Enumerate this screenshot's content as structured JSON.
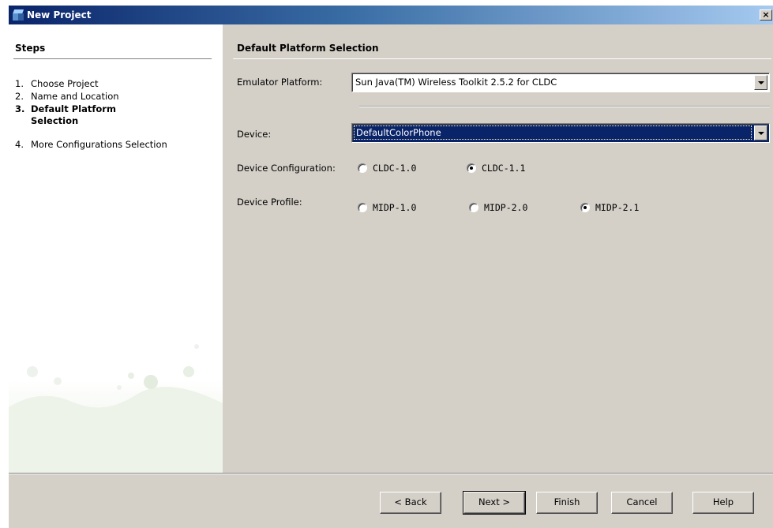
{
  "window": {
    "title": "New Project",
    "close_glyph": "×"
  },
  "steps": {
    "heading": "Steps",
    "items": [
      {
        "num": "1.",
        "label": "Choose Project"
      },
      {
        "num": "2.",
        "label": "Name and Location"
      },
      {
        "num": "3.",
        "label": "Default Platform Selection"
      },
      {
        "num": "4.",
        "label": "More Configurations Selection"
      }
    ]
  },
  "content": {
    "heading": "Default Platform Selection",
    "emulator_label": "Emulator Platform:",
    "emulator_value": "Sun Java(TM) Wireless Toolkit 2.5.2 for CLDC",
    "device_label": "Device:",
    "device_value": "DefaultColorPhone",
    "config_label": "Device Configuration:",
    "config_options": [
      "CLDC-1.0",
      "CLDC-1.1"
    ],
    "config_selected": "CLDC-1.1",
    "profile_label": "Device Profile:",
    "profile_options": [
      "MIDP-1.0",
      "MIDP-2.0",
      "MIDP-2.1"
    ],
    "profile_selected": "MIDP-2.1"
  },
  "buttons": {
    "back": "< Back",
    "next": "Next >",
    "finish": "Finish",
    "cancel": "Cancel",
    "help": "Help"
  },
  "icons": {
    "title": "netbeans-cube-icon"
  },
  "colors": {
    "title_bar": "#0a246a",
    "selection": "#0a246a",
    "dialog_bg": "#d4d0c8"
  }
}
